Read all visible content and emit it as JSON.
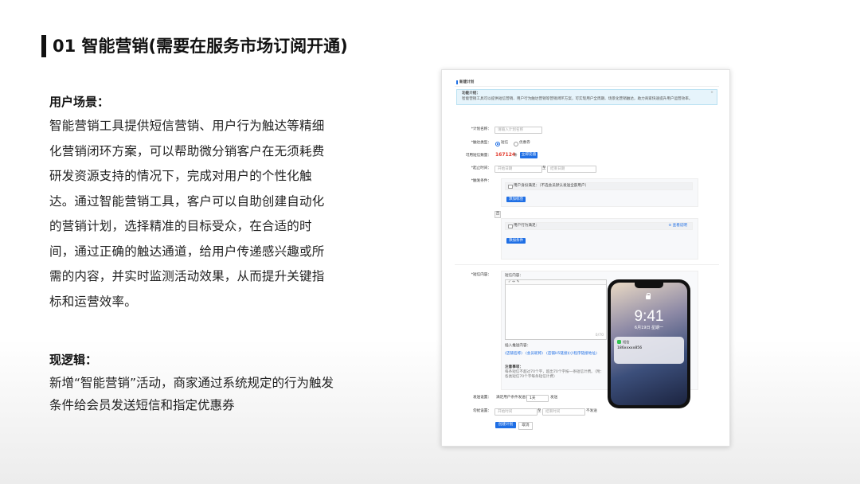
{
  "title": "01 智能营销(需要在服务市场订阅开通)",
  "scene": {
    "heading": "用户场景：",
    "body": "智能营销工具提供短信营销、用户行为触达等精细化营销闭环方案，可以帮助微分销客户在无须耗费研发资源支持的情况下，完成对用户的个性化触达。通过智能营销工具，客户可以自助创建自动化的营销计划，选择精准的目标受众，在合适的时间，通过正确的触达通道，给用户传递感兴趣或所需的内容，并实时监测活动效果，从而提升关键指标和运营效率。"
  },
  "logic": {
    "heading": "现逻辑：",
    "body": "新增“智能营销”活动，商家通过系统规定的行为触发条件给会员发送短信和指定优惠券"
  },
  "screenshot": {
    "page_title": "新建计划",
    "info_title": "功能介绍：",
    "info_text": "智能营销工具可以提供短信营销、用户行为触达营销等营销闭环方案，可实现用户全周期、场景化营销触达，助力商家快速提升用户运营效率。",
    "info_close": "×",
    "plan_name_label": "*计划名称：",
    "plan_name_placeholder": "请输入计划名称",
    "channel_label": "*触达类型：",
    "channel_sms": "短信",
    "channel_coupon": "优惠券",
    "available_sms_label": "可用短信数量：",
    "available_sms_value": "167124",
    "available_sms_unit": "条",
    "recharge_button": "立即充值",
    "time_label": "*起止时间：",
    "start_placeholder": "开始日期",
    "end_placeholder": "结束日期",
    "date_sep": "至",
    "condition_label": "*触发条件：",
    "cond1_text": "用户身份满足：（不选会员默认发送全部用户）",
    "add_tag_button": "添加标签",
    "and_or": "且",
    "cond2_text": "用户行为满足：",
    "cond2_link": "⊙ 查看说明",
    "add_condition_button": "添加条件",
    "content_label": "*短信内容：",
    "sms_content_label": "短信内容：",
    "sms_toolbar": "✓ ⇔ ✎",
    "counter": "0/70",
    "insert_label": "插入推送内容：",
    "insert_links": [
      "(店铺名称)",
      "(会员昵称)",
      "(店铺H5链接)",
      "(小程序链接地址)"
    ],
    "notes_label": "注意事项：",
    "notes_text": "每条短信不超过70个字，超出70个字按一条短信计费。（附：各类短信70个字每条短信计费）",
    "phone_time": "9:41",
    "phone_date": "6月19日 星期一",
    "notif_app": "短信",
    "notif_text": "186xxxxx856",
    "send_setting_label": "发送设置：",
    "send_setting_value": "满足用户条件发送前",
    "send_setting_select": "1天",
    "send_setting_suffix": "发送",
    "exclude_label": "勿扰设置：",
    "exclude_start": "开始时间",
    "exclude_end": "结束时间",
    "exclude_suffix": "不发送",
    "save_button": "创建计划",
    "cancel_button": "取消",
    "colors": {
      "primary": "#1f6fe5",
      "info_bg": "#e6f4fb",
      "danger": "#e33a2c"
    }
  }
}
